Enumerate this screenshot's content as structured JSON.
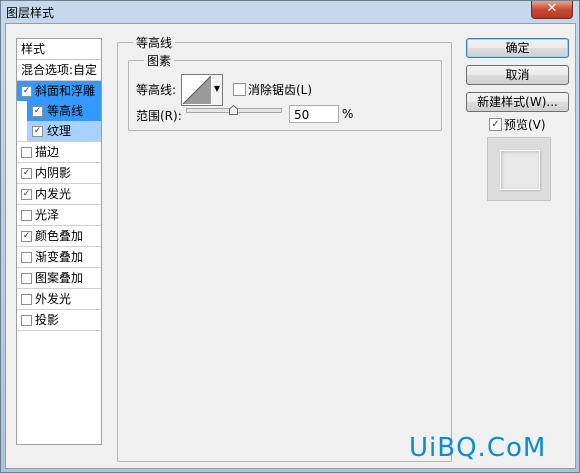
{
  "window": {
    "title": "图层样式",
    "close_glyph": "✕"
  },
  "style_list": {
    "header": "样式",
    "blend": "混合选项:自定",
    "items": [
      {
        "label": "斜面和浮雕",
        "checked": true
      },
      {
        "label": "等高线",
        "checked": true
      },
      {
        "label": "纹理",
        "checked": true
      },
      {
        "label": "描边",
        "checked": false
      },
      {
        "label": "内阴影",
        "checked": true
      },
      {
        "label": "内发光",
        "checked": true
      },
      {
        "label": "光泽",
        "checked": false
      },
      {
        "label": "颜色叠加",
        "checked": true
      },
      {
        "label": "渐变叠加",
        "checked": false
      },
      {
        "label": "图案叠加",
        "checked": false
      },
      {
        "label": "外发光",
        "checked": false
      },
      {
        "label": "投影",
        "checked": false
      }
    ]
  },
  "contour_panel": {
    "group_title": "等高线",
    "inner_title": "图素",
    "contour_label": "等高线:",
    "antialias_label": "消除锯齿(L)",
    "antialias_checked": false,
    "range_label": "范围(R):",
    "range_value": "50",
    "range_unit": "%",
    "range_level": 0.5
  },
  "buttons": {
    "ok": "确定",
    "cancel": "取消",
    "new_style": "新建样式(W)..."
  },
  "preview": {
    "label": "预览(V)",
    "checked": true
  },
  "watermark": "UiBQ.CoM",
  "colors": {
    "selection": "#3399ff",
    "sub_selection": "#a8d1ff",
    "watermark": "#0a8cd1"
  }
}
